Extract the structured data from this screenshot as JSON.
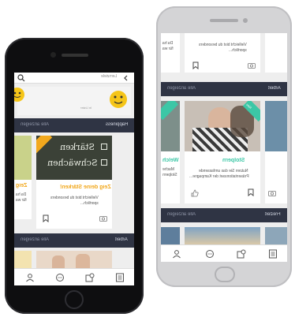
{
  "left_phone": {
    "search_placeholder": "Lernziele",
    "top_card": {
      "small_label": "In Lister"
    },
    "section_happiness": {
      "title": "Happiness",
      "more": "Alle anzeigen"
    },
    "card_strengths": {
      "title": "Zeig deine Stärken!",
      "description_line1": "Vielleicht bist du besonders",
      "description_line2": "sportlich...",
      "chalk_line1": "Stärken",
      "chalk_line2": "Schwächen"
    },
    "card_left_partial": {
      "title": "Zeig",
      "description_line1": "Da ha",
      "description_line2": "für wa"
    },
    "section_work": {
      "title": "Arbeit",
      "more": "Alle anzeigen"
    }
  },
  "right_phone": {
    "top_card": {
      "description_line1": "Vielleicht bist du besonders",
      "description_line2": "sportlich..."
    },
    "top_card_partial": {
      "description_line1": "Da ha",
      "description_line2": "für wa"
    },
    "section_work": {
      "title": "Arbeit",
      "more": "Alle anzeigen"
    },
    "card_stolpern": {
      "title": "Stolpern",
      "badge": "Neu",
      "description_line1": "Nutzen Sie das umfassende",
      "description_line2": "Präsentationsset der Kampagne..."
    },
    "card_partial": {
      "title": "Welch",
      "description_line1": "Mache",
      "description_line2": "Stolpern"
    },
    "section_leisure": {
      "title": "Freizeit",
      "more": "Alle anzeigen"
    }
  },
  "icons": {
    "search": "search-icon",
    "smiley": "smiley-icon",
    "bookmark": "bookmark-icon",
    "camera": "camera-icon",
    "thumb": "thumb-icon",
    "nav_profile": "profile-icon",
    "nav_chat": "chat-icon",
    "nav_tasks": "tasks-icon",
    "nav_notes": "notes-icon"
  },
  "colors": {
    "section_bar": "#2f3444",
    "accent_orange": "#f2a81d",
    "accent_green": "#3cc7a6",
    "smiley_yellow": "#f5c518",
    "screen_bg": "#eeeeee"
  }
}
